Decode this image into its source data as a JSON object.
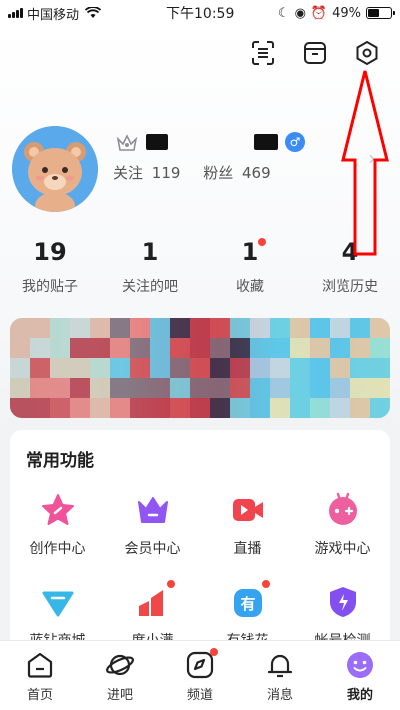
{
  "status_bar": {
    "carrier": "中国移动",
    "time": "下午10:59",
    "battery": "49%",
    "battery_level": 0.49
  },
  "header_icons": [
    "scan-icon",
    "box-icon",
    "settings-icon"
  ],
  "profile": {
    "follow_label": "关注",
    "follow_count": "119",
    "fans_label": "粉丝",
    "fans_count": "469",
    "gender": "♂",
    "arrow": "›"
  },
  "stats": [
    {
      "num": "19",
      "label": "我的贴子"
    },
    {
      "num": "1",
      "label": "关注的吧"
    },
    {
      "num": "1",
      "label": "收藏"
    },
    {
      "num": "4",
      "label": "浏览历史"
    }
  ],
  "functions": {
    "title": "常用功能",
    "items": [
      {
        "label": "创作中心",
        "icon": "star-icon",
        "color": "#f0539a"
      },
      {
        "label": "会员中心",
        "icon": "crown-icon",
        "color": "#9155f2"
      },
      {
        "label": "直播",
        "icon": "video-icon",
        "color": "#f0454f"
      },
      {
        "label": "游戏中心",
        "icon": "gamepad-icon",
        "color": "#ee5fa0"
      },
      {
        "label": "蓝钻商城",
        "icon": "diamond-icon",
        "color": "#35b8e8"
      },
      {
        "label": "度小满",
        "icon": "chart-icon",
        "color": "#f04848"
      },
      {
        "label": "有钱花",
        "icon": "money-icon",
        "color": "#36a3f0"
      },
      {
        "label": "帐号检测",
        "icon": "shield-icon",
        "color": "#8250f0"
      }
    ]
  },
  "tabbar": [
    {
      "label": "首页",
      "icon": "home-icon"
    },
    {
      "label": "进吧",
      "icon": "planet-icon"
    },
    {
      "label": "频道",
      "icon": "compass-icon"
    },
    {
      "label": "消息",
      "icon": "bell-icon"
    },
    {
      "label": "我的",
      "icon": "smile-icon"
    }
  ],
  "colors": {
    "accent_red": "#f5453a",
    "annotation_red": "#ff0000",
    "gender_blue": "#3d8cf5",
    "active_tab": "#9b6cf5"
  }
}
